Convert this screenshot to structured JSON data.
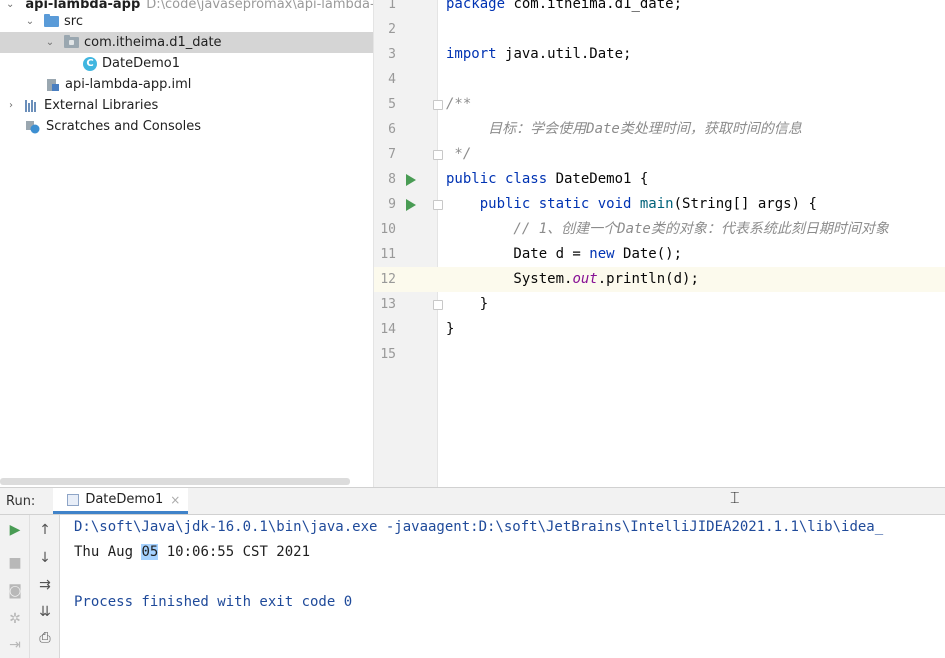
{
  "project": {
    "root": {
      "name": "api-lambda-app",
      "path": "D:\\code\\javasepromax\\api-lambda-a"
    },
    "items": [
      {
        "label": "src",
        "icon": "source-folder-icon"
      },
      {
        "label": "com.itheima.d1_date",
        "icon": "package-icon"
      },
      {
        "label": "DateDemo1",
        "icon": "java-class-icon",
        "badge": "C"
      },
      {
        "label": "api-lambda-app.iml",
        "icon": "module-file-icon"
      },
      {
        "label": "External Libraries",
        "icon": "libraries-icon"
      },
      {
        "label": "Scratches and Consoles",
        "icon": "scratches-icon"
      }
    ]
  },
  "editor": {
    "current_line": 12,
    "lines": [
      {
        "n": "1",
        "tokens": [
          {
            "t": "package ",
            "c": "kw"
          },
          {
            "t": "com.itheima.d1_date;",
            "c": ""
          }
        ]
      },
      {
        "n": "2",
        "tokens": []
      },
      {
        "n": "3",
        "tokens": [
          {
            "t": "import ",
            "c": "kw"
          },
          {
            "t": "java.util.Date;",
            "c": ""
          }
        ]
      },
      {
        "n": "4",
        "tokens": []
      },
      {
        "n": "5",
        "tokens": [
          {
            "t": "/**",
            "c": "doc"
          }
        ]
      },
      {
        "n": "6",
        "tokens": [
          {
            "t": "     目标：学会使用Date类处理时间，获取时间的信息",
            "c": "doc"
          }
        ]
      },
      {
        "n": "7",
        "tokens": [
          {
            "t": " */",
            "c": "doc"
          }
        ]
      },
      {
        "n": "8",
        "tokens": [
          {
            "t": "public class ",
            "c": "kw"
          },
          {
            "t": "DateDemo1 {",
            "c": ""
          }
        ]
      },
      {
        "n": "9",
        "tokens": [
          {
            "t": "    public static void ",
            "c": "kw"
          },
          {
            "t": "main",
            "c": "fn"
          },
          {
            "t": "(String[] args) {",
            "c": ""
          }
        ]
      },
      {
        "n": "10",
        "tokens": [
          {
            "t": "        // 1、创建一个Date类的对象：代表系统此刻日期时间对象",
            "c": "cmt"
          }
        ]
      },
      {
        "n": "11",
        "tokens": [
          {
            "t": "        Date d = ",
            "c": ""
          },
          {
            "t": "new ",
            "c": "kw"
          },
          {
            "t": "Date();",
            "c": ""
          }
        ]
      },
      {
        "n": "12",
        "tokens": [
          {
            "t": "        System.",
            "c": ""
          },
          {
            "t": "out",
            "c": "fld"
          },
          {
            "t": ".println(d);",
            "c": ""
          }
        ]
      },
      {
        "n": "13",
        "tokens": [
          {
            "t": "    }",
            "c": ""
          }
        ]
      },
      {
        "n": "14",
        "tokens": [
          {
            "t": "}",
            "c": ""
          }
        ]
      },
      {
        "n": "15",
        "tokens": []
      }
    ]
  },
  "run": {
    "label": "Run:",
    "tab": "DateDemo1",
    "close_glyph": "×",
    "console": {
      "command": "D:\\soft\\Java\\jdk-16.0.1\\bin\\java.exe -javaagent:D:\\soft\\JetBrains\\IntelliJIDEA2021.1.1\\lib\\idea_",
      "output_prefix": "Thu Aug ",
      "output_selected": "05",
      "output_suffix": " 10:06:55 CST 2021",
      "finish": "Process finished with exit code 0"
    }
  },
  "colors": {
    "keyword": "#0033b3",
    "comment": "#8c8c8c",
    "field": "#871094",
    "run_green": "#499c54",
    "selection": "#d5d5d5",
    "console_text": "#1f4a9a"
  }
}
